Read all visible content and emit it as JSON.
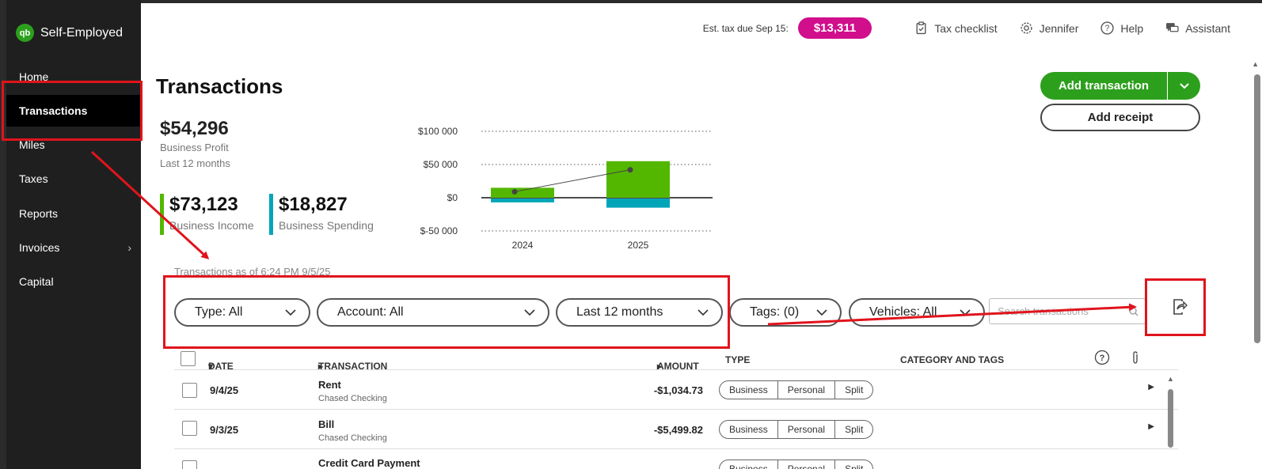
{
  "app": {
    "logo_mark": "qb",
    "name": "Self-Employed"
  },
  "sidebar": {
    "items": [
      {
        "label": "Home"
      },
      {
        "label": "Transactions",
        "active": true
      },
      {
        "label": "Miles"
      },
      {
        "label": "Taxes"
      },
      {
        "label": "Reports"
      },
      {
        "label": "Invoices",
        "has_submenu": true
      },
      {
        "label": "Capital"
      }
    ]
  },
  "header": {
    "est_tax_label": "Est. tax due Sep 15:",
    "est_tax_value": "$13,311",
    "tax_checklist": "Tax checklist",
    "user": "Jennifer",
    "help": "Help",
    "assistant": "Assistant"
  },
  "page": {
    "title": "Transactions",
    "add_transaction": "Add transaction",
    "add_receipt": "Add receipt"
  },
  "summary": {
    "profit_amount": "$54,296",
    "profit_label": "Business Profit",
    "profit_period": "Last 12 months",
    "income_amount": "$73,123",
    "income_label": "Business Income",
    "spending_amount": "$18,827",
    "spending_label": "Business Spending"
  },
  "chart_data": {
    "type": "bar",
    "categories": [
      "2024",
      "2025"
    ],
    "series": [
      {
        "name": "Business Income",
        "values": [
          15000,
          55000
        ],
        "color": "#53b700"
      },
      {
        "name": "Business Spending",
        "values": [
          -7000,
          -15000
        ],
        "color": "#00a6b8"
      },
      {
        "name": "Business Profit",
        "values": [
          9000,
          42000
        ],
        "color": "#444444"
      }
    ],
    "y_ticks": [
      "$100 000",
      "$50 000",
      "$0",
      "$-50 000"
    ],
    "ylim": [
      -50000,
      100000
    ],
    "grid": true
  },
  "filters": {
    "as_of": "Transactions as of 6:24 PM 9/5/25",
    "type": "Type: All",
    "account": "Account: All",
    "period": "Last 12 months",
    "tags": "Tags: (0)",
    "vehicles": "Vehicles: All",
    "search_placeholder": "Search transactions"
  },
  "table": {
    "headers": {
      "date": "DATE",
      "transaction": "TRANSACTION",
      "amount": "AMOUNT",
      "type": "TYPE",
      "category": "CATEGORY AND TAGS"
    },
    "type_options": [
      "Business",
      "Personal",
      "Split"
    ],
    "rows": [
      {
        "date": "9/4/25",
        "name": "Rent",
        "account": "Chased Checking",
        "amount": "-$1,034.73"
      },
      {
        "date": "9/3/25",
        "name": "Bill",
        "account": "Chased Checking",
        "amount": "-$5,499.82"
      },
      {
        "date": "",
        "name": "Credit Card Payment",
        "account": "",
        "amount": ""
      }
    ]
  },
  "colors": {
    "brand_green": "#2ca01c",
    "tax_pink": "#d10e8c",
    "annotation_red": "#e0141c",
    "income_green": "#53b700",
    "spending_teal": "#00a6b8"
  }
}
